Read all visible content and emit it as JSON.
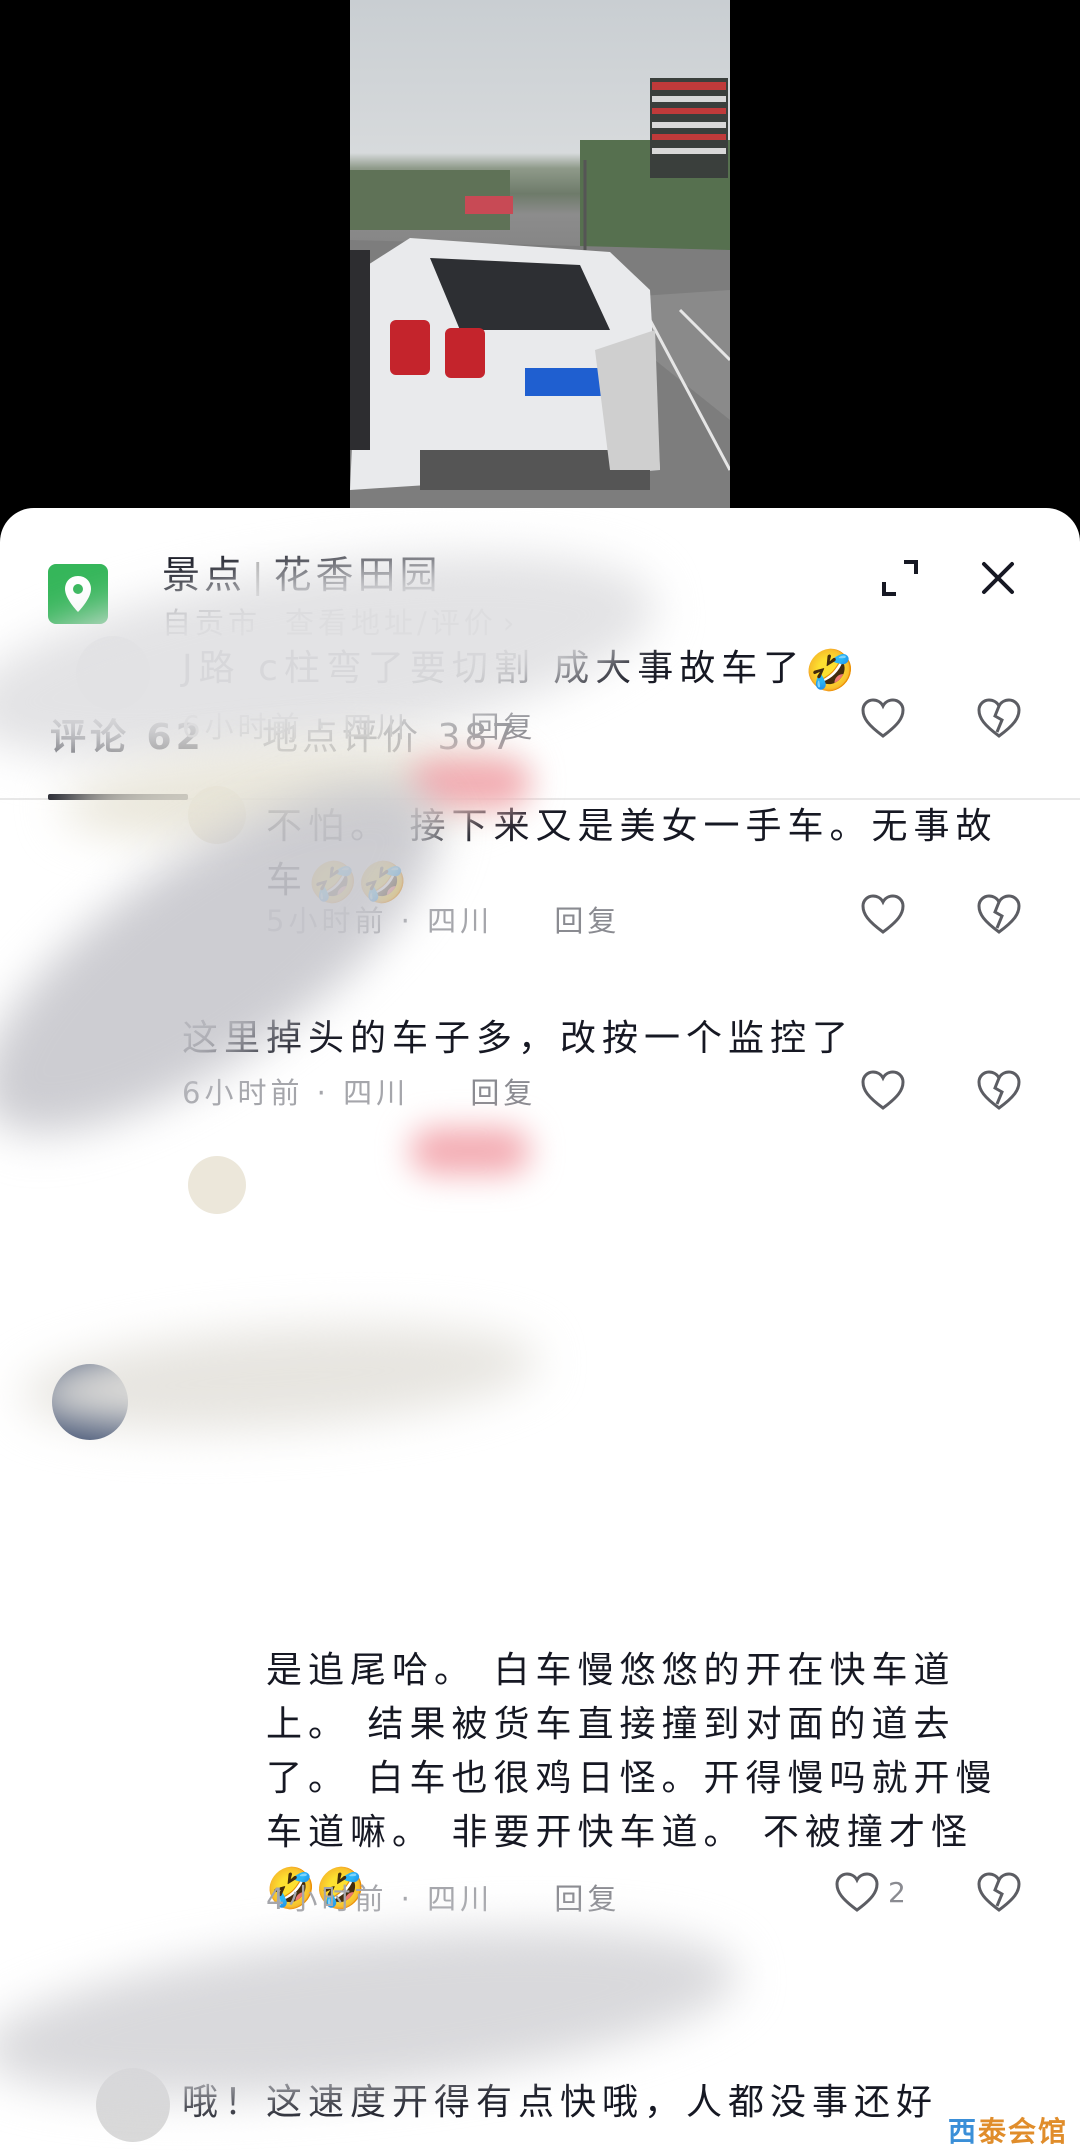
{
  "location": {
    "category": "景点",
    "name": "花香田园",
    "city": "自贡市",
    "link_label": "查看地址/评价",
    "chevron": "›",
    "icon": "map-pin-icon",
    "icon_color": "#35b65a"
  },
  "tabs": [
    {
      "label": "评论 62",
      "active": true
    },
    {
      "label": "地点评价 387",
      "active": false
    }
  ],
  "comments": [
    {
      "text": "路 c柱弯了要切割 成大事故车了",
      "prefix_partial": "J",
      "emoji": "🤣",
      "time": "6小时前",
      "region": "四川",
      "reply_label": "回复",
      "like_count": ""
    },
    {
      "text": "不怕。 接下来又是美女一手车。无事故车",
      "emoji": "🤣🤣",
      "time": "5小时前",
      "region": "四川",
      "reply_label": "回复",
      "like_count": ""
    },
    {
      "text": "这里掉头的车子多，改按一个监控了",
      "time": "6小时前",
      "region": "四川",
      "reply_label": "回复",
      "like_count": ""
    },
    {
      "text": "是追尾哈。 白车慢悠悠的开在快车道上。 结果被货车直接撞到对面的道去了。 白车也很鸡日怪。开得慢吗就开慢车道嘛。 非要开快车道。 不被撞才怪",
      "emoji": "🤣🤣",
      "time": "4小时前",
      "region": "四川",
      "reply_label": "回复",
      "like_count": "2"
    },
    {
      "text": "哦！这速度开得有点快哦，人都没事还好",
      "time": "",
      "region": "",
      "reply_label": "",
      "like_count": ""
    }
  ],
  "meta_separator": "·",
  "watermark": {
    "part1": "西",
    "part2": "泰会馆"
  },
  "colors": {
    "text_primary": "#161823",
    "text_secondary": "#8a8b91",
    "accent_green": "#35b65a",
    "watermark": "#e08d2b"
  }
}
